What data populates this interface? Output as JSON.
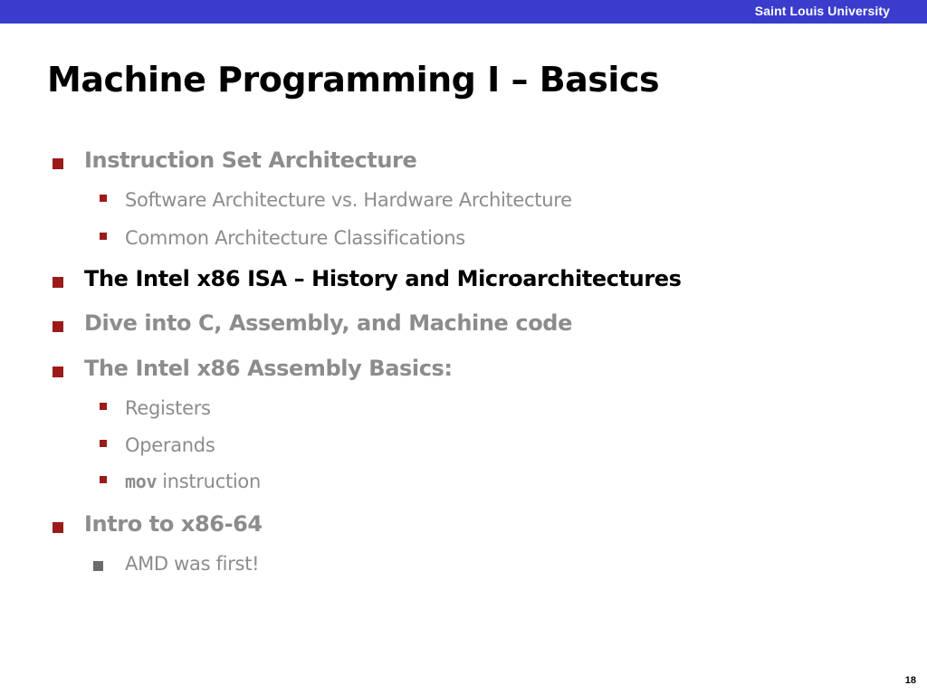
{
  "header": {
    "brand": "Saint Louis University"
  },
  "slide": {
    "title": "Machine Programming I – Basics",
    "bullets": [
      {
        "text": "Instruction Set Architecture",
        "sub": [
          "Software Architecture vs. Hardware Architecture",
          "Common Architecture Classifications"
        ]
      },
      {
        "text": "The Intel x86 ISA – History and Microarchitectures",
        "active": true
      },
      {
        "text": "Dive into C, Assembly, and Machine code"
      },
      {
        "text": "The Intel x86 Assembly Basics:",
        "sub": [
          "Registers",
          "Operands",
          {
            "code": "mov",
            "text": "instruction"
          }
        ]
      },
      {
        "text": "Intro to x86-64",
        "sub": [
          "AMD was first!"
        ]
      }
    ]
  },
  "footer": {
    "page_number": "18"
  },
  "colors": {
    "header_bar": "#3a3ccc",
    "bullet_red": "#9b1b1b",
    "text_dimmed": "#8c8c8c",
    "text_active": "#000000"
  }
}
